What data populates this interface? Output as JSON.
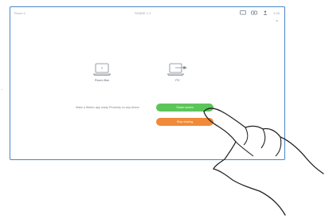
{
  "topbar": {
    "left_text": "Room 1",
    "center_text": "SHARE 1 2",
    "time": "1:00",
    "icons": [
      "screen-share-icon",
      "camera-icon",
      "person-icon"
    ]
  },
  "close_symbol": "×",
  "devices": [
    {
      "icon": "laptop-icon",
      "label": "Room Bar"
    },
    {
      "icon": "pc-cable-icon",
      "label": "PC"
    }
  ],
  "instruction": "Make a Webex app ready Proximity on any device",
  "buttons": {
    "share_label": "Share screen",
    "stop_label": "Stop sharing"
  },
  "edge_mark": "·"
}
